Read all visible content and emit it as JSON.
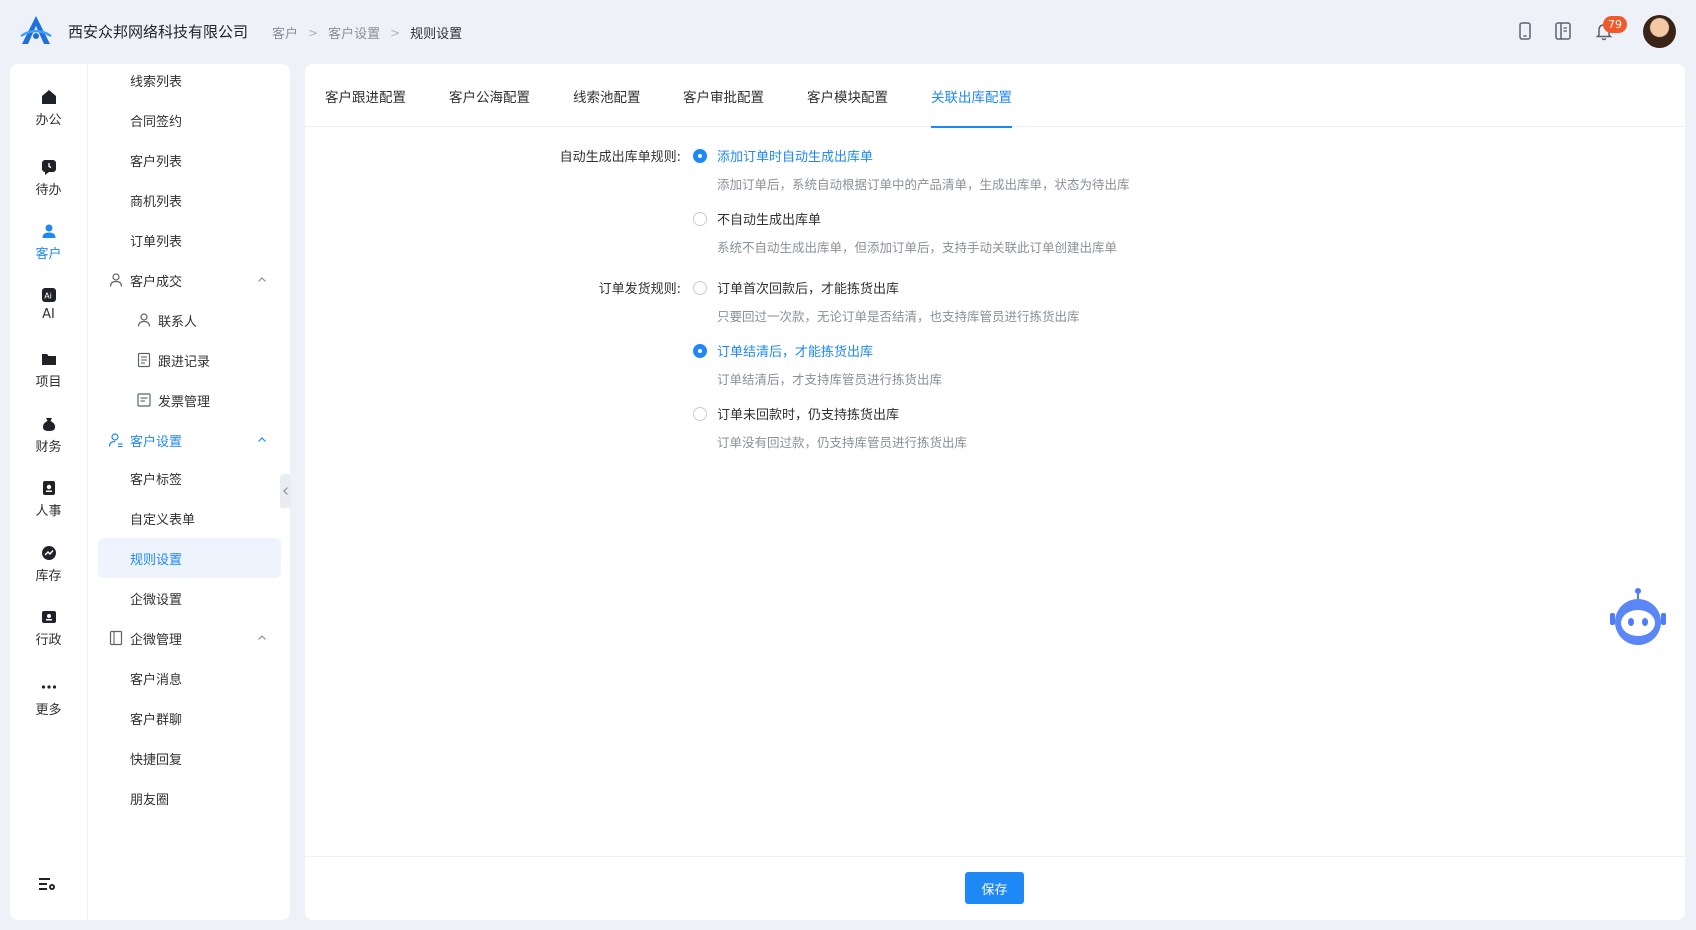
{
  "header": {
    "company": "西安众邦网络科技有限公司",
    "breadcrumb": [
      "客户",
      "客户设置",
      "规则设置"
    ],
    "notification_count": "79"
  },
  "rail": [
    {
      "label": "办公",
      "icon": "home-icon"
    },
    {
      "label": "待办",
      "icon": "todo-icon"
    },
    {
      "label": "客户",
      "icon": "customer-icon",
      "active": true
    },
    {
      "label": "AI",
      "icon": "ai-icon"
    },
    {
      "label": "项目",
      "icon": "folder-icon"
    },
    {
      "label": "财务",
      "icon": "money-bag-icon"
    },
    {
      "label": "人事",
      "icon": "badge-icon"
    },
    {
      "label": "库存",
      "icon": "chart-icon"
    },
    {
      "label": "行政",
      "icon": "admin-icon"
    },
    {
      "label": "更多",
      "icon": "more-icon"
    }
  ],
  "submenu": {
    "items": [
      {
        "label": "线索列表"
      },
      {
        "label": "合同签约"
      },
      {
        "label": "客户列表"
      },
      {
        "label": "商机列表"
      },
      {
        "label": "订单列表"
      },
      {
        "label": "客户成交"
      },
      {
        "label": "联系人"
      },
      {
        "label": "跟进记录"
      },
      {
        "label": "发票管理"
      },
      {
        "label": "客户设置"
      },
      {
        "label": "客户标签"
      },
      {
        "label": "自定义表单"
      },
      {
        "label": "规则设置"
      },
      {
        "label": "企微设置"
      },
      {
        "label": "企微管理"
      },
      {
        "label": "客户消息"
      },
      {
        "label": "客户群聊"
      },
      {
        "label": "快捷回复"
      },
      {
        "label": "朋友圈"
      }
    ]
  },
  "tabs": [
    "客户跟进配置",
    "客户公海配置",
    "线索池配置",
    "客户审批配置",
    "客户模块配置",
    "关联出库配置"
  ],
  "form": {
    "auto_label": "自动生成出库单规则:",
    "auto_opt1": "添加订单时自动生成出库单",
    "auto_opt1_hint": "添加订单后，系统自动根据订单中的产品清单，生成出库单，状态为待出库",
    "auto_opt2": "不自动生成出库单",
    "auto_opt2_hint": "系统不自动生成出库单，但添加订单后，支持手动关联此订单创建出库单",
    "ship_label": "订单发货规则:",
    "ship_opt1": "订单首次回款后，才能拣货出库",
    "ship_opt1_hint": "只要回过一次款，无论订单是否结清，也支持库管员进行拣货出库",
    "ship_opt2": "订单结清后，才能拣货出库",
    "ship_opt2_hint": "订单结清后，才支持库管员进行拣货出库",
    "ship_opt3": "订单未回款时，仍支持拣货出库",
    "ship_opt3_hint": "订单没有回过款，仍支持库管员进行拣货出库"
  },
  "save_label": "保存",
  "colors": {
    "accent": "#1e88f5",
    "badge": "#f05a2a"
  }
}
